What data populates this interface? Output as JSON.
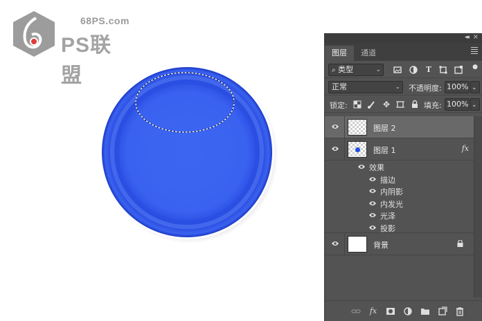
{
  "watermark": {
    "url": "68PS.com",
    "brand": "PS联盟"
  },
  "artwork": {
    "fill_color": "#2a55f0",
    "selection": "elliptical marquee"
  },
  "panel": {
    "tabs": [
      {
        "label": "图层",
        "active": true
      },
      {
        "label": "通道",
        "active": false
      }
    ],
    "filter": {
      "kind_label": "类型"
    },
    "blend": {
      "mode": "正常",
      "opacity_label": "不透明度:",
      "opacity_value": "100%"
    },
    "lock": {
      "label": "锁定:",
      "fill_label": "填充:",
      "fill_value": "100%"
    },
    "layers": [
      {
        "name": "图层 2",
        "selected": true,
        "visible": true
      },
      {
        "name": "图层 1",
        "selected": false,
        "visible": true,
        "fx": "fx"
      },
      {
        "name": "背景",
        "selected": false,
        "visible": true,
        "locked": true
      }
    ],
    "effects_label": "效果",
    "effects": [
      "描边",
      "内阴影",
      "内发光",
      "光泽",
      "投影"
    ]
  },
  "icons": {
    "eye": "eye-icon",
    "lock": "lock-icon",
    "link": "link-icon",
    "fx": "fx-icon",
    "mask": "add-mask-icon",
    "adjust": "adjustment-layer-icon",
    "folder": "new-group-icon",
    "new": "new-layer-icon",
    "trash": "trash-icon"
  }
}
